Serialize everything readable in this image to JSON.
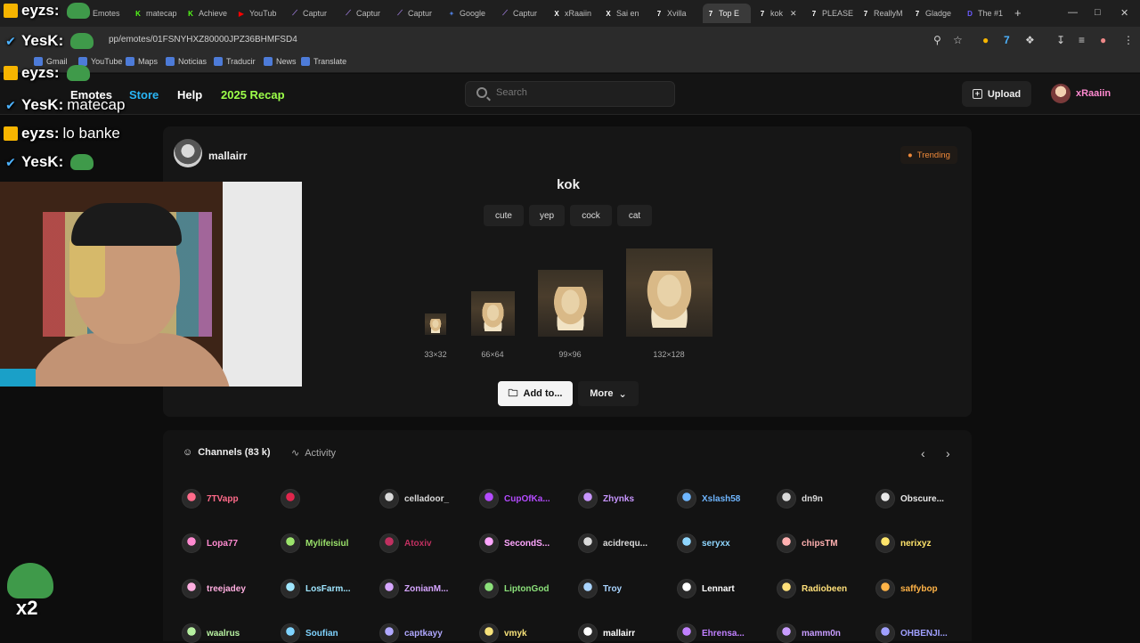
{
  "browser": {
    "tabs": [
      {
        "label": "",
        "color": "#7d7d7d",
        "fav": ""
      },
      {
        "label": "Emotes",
        "color": "#7d7d7d",
        "fav": ""
      },
      {
        "label": "matecap",
        "color": "#53fc18",
        "fav": "K"
      },
      {
        "label": "Achieve",
        "color": "#53fc18",
        "fav": "K"
      },
      {
        "label": "YouTub",
        "color": "#ff0000",
        "fav": "▶"
      },
      {
        "label": "Captur",
        "color": "#9b7bd8",
        "fav": "⟋"
      },
      {
        "label": "Captur",
        "color": "#9b7bd8",
        "fav": "⟋"
      },
      {
        "label": "Captur",
        "color": "#9b7bd8",
        "fav": "⟋"
      },
      {
        "label": "Google",
        "color": "#4d7bd8",
        "fav": "✦"
      },
      {
        "label": "Captur",
        "color": "#9b7bd8",
        "fav": "⟋"
      },
      {
        "label": "xRaaiin",
        "color": "#ffffff",
        "fav": "X"
      },
      {
        "label": "Sai en",
        "color": "#ffffff",
        "fav": "X"
      },
      {
        "label": "Xvilla",
        "color": "#ffffff",
        "fav": "7"
      },
      {
        "label": "Top E",
        "color": "#ffffff",
        "fav": "7"
      },
      {
        "label": "kok",
        "color": "#ffffff",
        "fav": "7"
      },
      {
        "label": "PLEASE",
        "color": "#ffffff",
        "fav": "7"
      },
      {
        "label": "ReallyM",
        "color": "#ffffff",
        "fav": "7"
      },
      {
        "label": "Gladge",
        "color": "#ffffff",
        "fav": "7"
      },
      {
        "label": "The #1",
        "color": "#6b5bff",
        "fav": "D"
      }
    ],
    "new_tab": "+",
    "url": "pp/emotes/01FSNYHXZ80000JPZ36BHMFSD4",
    "bookmarks": [
      {
        "label": "Gmail"
      },
      {
        "label": "YouTube"
      },
      {
        "label": "Maps"
      },
      {
        "label": "Noticias"
      },
      {
        "label": "Traducir"
      },
      {
        "label": "News"
      },
      {
        "label": "Translate"
      }
    ]
  },
  "site": {
    "nav": {
      "emotes": "Emotes",
      "store": "Store",
      "help": "Help",
      "recap": "2025 Recap"
    },
    "search_placeholder": "Search",
    "upload": "Upload",
    "user": "xRaaiin"
  },
  "emote": {
    "owner": "mallairr",
    "trending": "Trending",
    "name": "kok",
    "tags": [
      "cute",
      "yep",
      "cock",
      "cat"
    ],
    "sizes": [
      "33×32",
      "66×64",
      "99×96",
      "132×128"
    ],
    "add_to": "Add to...",
    "more": "More"
  },
  "channels": {
    "tab_channels": "Channels (83 k)",
    "tab_activity": "Activity",
    "rows": [
      [
        {
          "name": "7TVapp",
          "color": "#ff6b8a"
        },
        {
          "name": "",
          "color": "#e0264c"
        },
        {
          "name": "celladoor_",
          "color": "#d9d9d9"
        },
        {
          "name": "CupOfKa...",
          "color": "#b44bff"
        },
        {
          "name": "Zhynks",
          "color": "#c896ff"
        },
        {
          "name": "Xslash58",
          "color": "#6fb6ff"
        },
        {
          "name": "dn9n",
          "color": "#d9d9d9"
        },
        {
          "name": "Obscure...",
          "color": "#e8e8e8"
        }
      ],
      [
        {
          "name": "Lopa77",
          "color": "#ff8ad0"
        },
        {
          "name": "Mylifeisiul",
          "color": "#9be36b"
        },
        {
          "name": "Atoxiv",
          "color": "#c03060"
        },
        {
          "name": "SecondS...",
          "color": "#ffa6ff"
        },
        {
          "name": "acidrequ...",
          "color": "#d9d9d9"
        },
        {
          "name": "seryxx",
          "color": "#8fd6ff"
        },
        {
          "name": "chipsTM",
          "color": "#ffb0b0"
        },
        {
          "name": "nerixyz",
          "color": "#ffe46b"
        }
      ],
      [
        {
          "name": "treejadey",
          "color": "#ffaee0"
        },
        {
          "name": "LosFarm...",
          "color": "#9fe6ff"
        },
        {
          "name": "ZonianM...",
          "color": "#d6a6ff"
        },
        {
          "name": "LiptonGod",
          "color": "#8be07a"
        },
        {
          "name": "Troy",
          "color": "#a9d4ff"
        },
        {
          "name": "Lennart",
          "color": "#ffffff"
        },
        {
          "name": "Radiobeen",
          "color": "#ffe07a"
        },
        {
          "name": "saffybop",
          "color": "#ffb347"
        }
      ],
      [
        {
          "name": "waalrus",
          "color": "#b6f0a0"
        },
        {
          "name": "Soufian",
          "color": "#7fd3ff"
        },
        {
          "name": "captkayy",
          "color": "#b0a8ff"
        },
        {
          "name": "vmyk",
          "color": "#f7e27a"
        },
        {
          "name": "mallairr",
          "color": "#ffffff"
        },
        {
          "name": "Ehrensa...",
          "color": "#c080ff"
        },
        {
          "name": "mamm0n",
          "color": "#c89cff"
        },
        {
          "name": "OHBENJI...",
          "color": "#a0a0ff"
        }
      ]
    ]
  },
  "overlay": {
    "chat": [
      {
        "user": "eyzs:",
        "msg": "",
        "user_color": "#ffffff"
      },
      {
        "user": "YesK:",
        "msg": "",
        "user_color": "#ffffff"
      },
      {
        "user": "eyzs:",
        "msg": "",
        "user_color": "#ffffff"
      },
      {
        "user": "YesK:",
        "msg": "matecap",
        "user_color": "#ffffff"
      },
      {
        "user": "eyzs:",
        "msg": "lo banke",
        "user_color": "#ffffff"
      },
      {
        "user": "YesK:",
        "msg": "",
        "user_color": "#ffffff"
      }
    ],
    "multiplier": "x2"
  }
}
